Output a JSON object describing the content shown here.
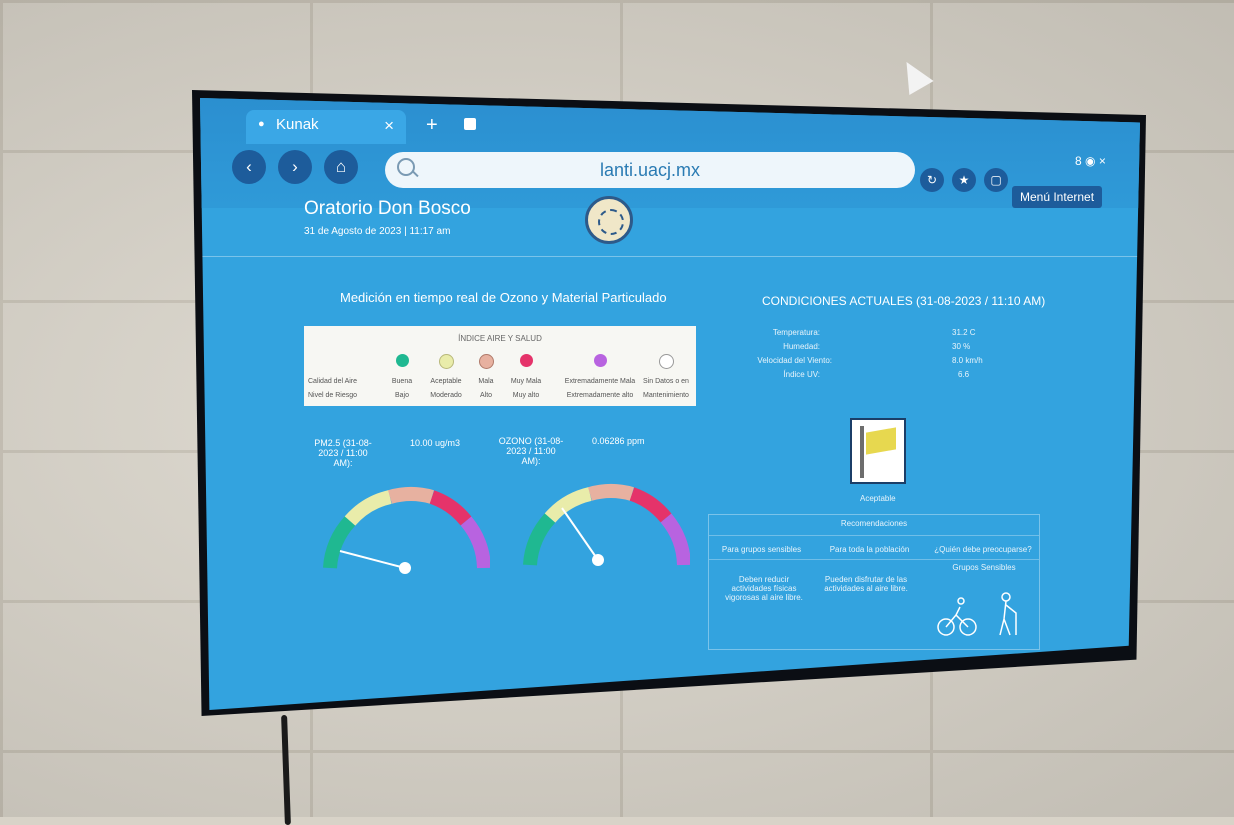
{
  "browser": {
    "tab_title": "Kunak",
    "tab_close": "×",
    "new_tab": "+",
    "url": "lanti.uacj.mx",
    "menu_tooltip": "Menú Internet",
    "top_right": "8  ◉  ×"
  },
  "site": {
    "title": "Oratorio Don Bosco",
    "datetime": "31 de Agosto de 2023 | 11:17 am"
  },
  "measurement": {
    "title": "Medición en tiempo real de Ozono y Material Particulado",
    "legend": {
      "header": "ÍNDICE AIRE Y SALUD",
      "row1_label": "Calidad del Aire",
      "row2_label": "Nivel de Riesgo",
      "levels": [
        {
          "quality": "Buena",
          "risk": "Bajo",
          "color": "#1fb891"
        },
        {
          "quality": "Aceptable",
          "risk": "Moderado",
          "color": "#e9ecaa"
        },
        {
          "quality": "Mala",
          "risk": "Alto",
          "color": "#e7b1a0"
        },
        {
          "quality": "Muy Mala",
          "risk": "Muy alto",
          "color": "#e5336a"
        },
        {
          "quality": "Extremadamente Mala",
          "risk": "Extremadamente alto",
          "color": "#b863e0"
        },
        {
          "quality": "Sin Datos o en",
          "risk": "Mantenimiento",
          "color": "#ffffff"
        }
      ]
    },
    "pm25": {
      "label": "PM2.5 (31-08-2023 / 11:00 AM):",
      "value": "10.00 ug/m3"
    },
    "ozone": {
      "label": "OZONO (31-08-2023 / 11:00 AM):",
      "value": "0.06286 ppm"
    }
  },
  "conditions": {
    "title": "CONDICIONES ACTUALES (31-08-2023 / 11:10 AM)",
    "items": [
      {
        "label": "Temperatura:",
        "value": "31.2 C"
      },
      {
        "label": "Humedad:",
        "value": "30 %"
      },
      {
        "label": "Velocidad del Viento:",
        "value": "8.0 km/h"
      },
      {
        "label": "Índice UV:",
        "value": "6.6"
      }
    ],
    "status": "Aceptable"
  },
  "recommendations": {
    "header": "Recomendaciones",
    "col1_head": "Para grupos sensibles",
    "col2_head": "Para toda la población",
    "col3_head": "¿Quién debe preocuparse?",
    "col1_text": "Deben reducir actividades físicas vigorosas al aire libre.",
    "col2_text": "Pueden disfrutar de las actividades al aire libre.",
    "col3_text": "Grupos Sensibles"
  },
  "colors": {
    "screen": "#33a3df",
    "gauge": [
      "#1fb891",
      "#e9ecaa",
      "#e7b1a0",
      "#e5336a",
      "#b863e0"
    ]
  }
}
